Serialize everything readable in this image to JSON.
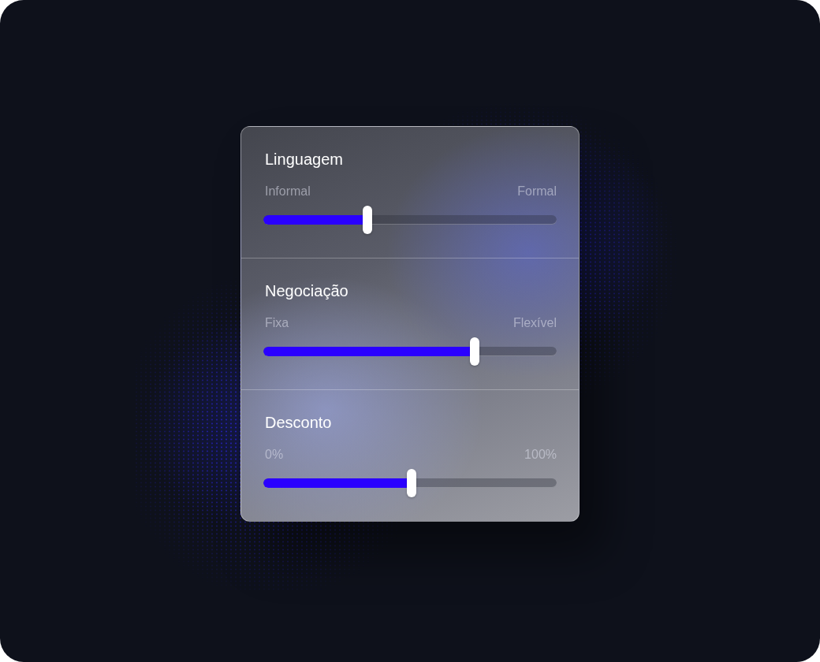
{
  "sliders": [
    {
      "title": "Linguagem",
      "min_label": "Informal",
      "max_label": "Formal",
      "level": 0.355
    },
    {
      "title": "Negociação",
      "min_label": "Fixa",
      "max_label": "Flexível",
      "level": 0.72
    },
    {
      "title": "Desconto",
      "min_label": "0%",
      "max_label": "100%",
      "level": 0.505
    }
  ]
}
